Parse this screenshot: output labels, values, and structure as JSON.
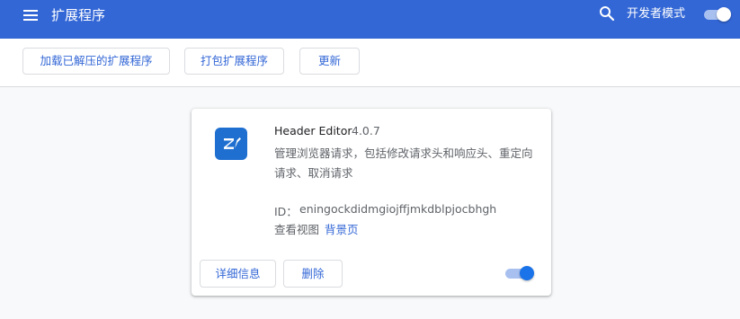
{
  "header": {
    "title": "扩展程序",
    "menu_icon": "hamburger-menu-icon",
    "search_icon": "search-icon",
    "developer_mode_label": "开发者模式",
    "developer_mode_on": true,
    "background_color": "#3367d6"
  },
  "toolbar": {
    "load_unpacked_label": "加载已解压的扩展程序",
    "pack_label": "打包扩展程序",
    "update_label": "更新"
  },
  "extension": {
    "icon": "header-editor-pencil-icon",
    "name": "Header Editor",
    "version": "4.0.7",
    "description": "管理浏览器请求，包括修改请求头和响应头、重定向请求、取消请求",
    "id_label": "ID：",
    "id": "eningockdidmgiojffjmkdblpjocbhgh",
    "inspect_views_label": "查看视图",
    "inspect_views_link": "背景页",
    "details_button": "详细信息",
    "remove_button": "删除",
    "enabled": true,
    "accent_color": "#1a73e8"
  }
}
